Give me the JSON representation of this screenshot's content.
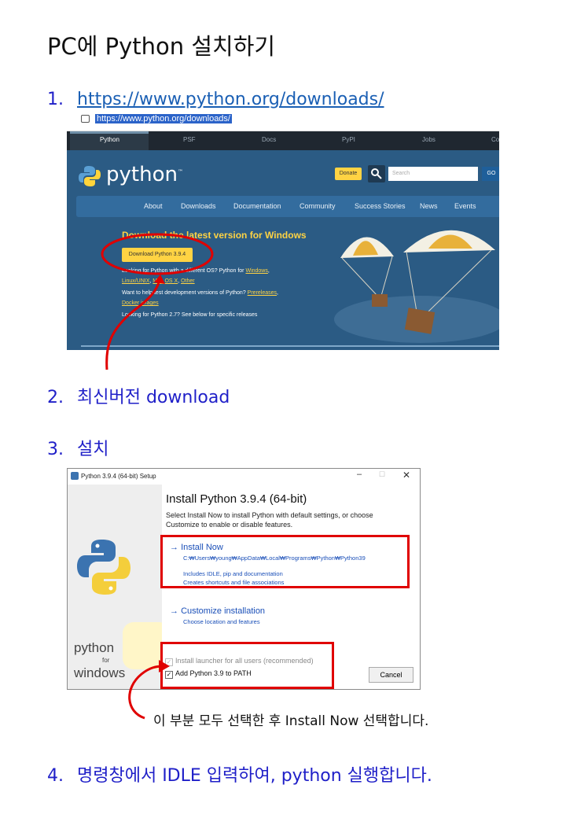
{
  "title": "PC에 Python 설치하기",
  "steps": [
    {
      "num": "1.",
      "link": "https://www.python.org/downloads/"
    },
    {
      "num": "2.",
      "text": "최신버전 download"
    },
    {
      "num": "3.",
      "text": "설치"
    },
    {
      "num": "4.",
      "text": "명령창에서 IDLE 입력하여, python 실행합니다."
    }
  ],
  "browser": {
    "url": "https://www.python.org/downloads/",
    "top_tabs": [
      "Python",
      "PSF",
      "Docs",
      "PyPI",
      "Jobs",
      "Co"
    ],
    "logo_text": "python",
    "logo_tm": "™",
    "donate": "Donate",
    "search_placeholder": "Search",
    "go": "GO",
    "nav": [
      "About",
      "Downloads",
      "Documentation",
      "Community",
      "Success Stories",
      "News",
      "Events"
    ],
    "headline": "Download the latest version for Windows",
    "download_button": "Download Python 3.9.4",
    "line1_a": "Looking for Python with a different OS? Python for ",
    "line1_link": "Windows",
    "line2_l1": "Linux/UNIX",
    "line2_l2": "Mac OS X",
    "line2_l3": "Other",
    "line3_a": "Want to help test development versions of Python? ",
    "line3_link": "Prereleases",
    "line4_link": "Docker images",
    "line5": "Looking for Python 2.7? See below for specific releases"
  },
  "installer": {
    "window_title": "Python 3.9.4 (64-bit) Setup",
    "heading": "Install Python 3.9.4 (64-bit)",
    "desc_a": "Select Install Now to install Python with default settings, or choose",
    "desc_b": "Customize to enable or disable features.",
    "install_now": "Install Now",
    "install_path": "C:₩Users₩young₩AppData₩Local₩Programs₩Python₩Python39",
    "includes_1": "Includes IDLE, pip and documentation",
    "includes_2": "Creates shortcuts and file associations",
    "customize": "Customize installation",
    "customize_sub": "Choose location and features",
    "check_launcher": "Install launcher for all users (recommended)",
    "check_path": "Add Python 3.9 to PATH",
    "cancel": "Cancel",
    "side_word": "python",
    "side_for": "for",
    "side_windows": "windows"
  },
  "note": "이 부분 모두 선택한 후 Install Now 선택합니다.",
  "colors": {
    "annotation_red": "#e00000",
    "step_blue": "#1f1fc8",
    "python_yellow": "#ffd343",
    "python_blue": "#2b5b84"
  }
}
